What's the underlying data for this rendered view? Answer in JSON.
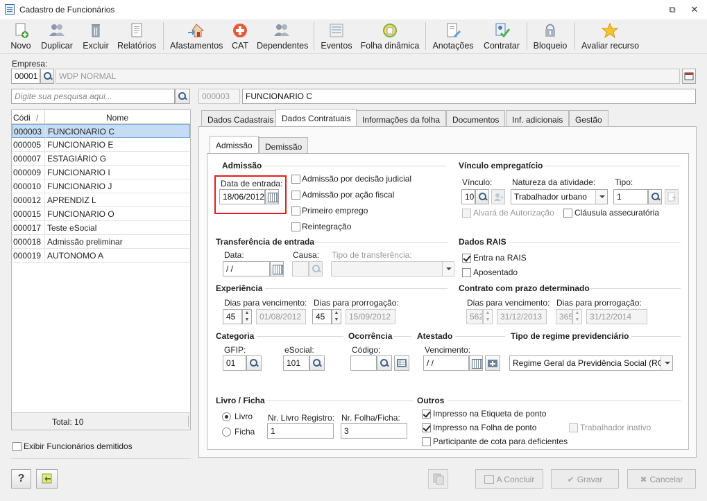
{
  "window": {
    "title": "Cadastro de Funcionários"
  },
  "toolbar": [
    {
      "label": "Novo",
      "icon": "new-doc-icon"
    },
    {
      "label": "Duplicar",
      "icon": "users-icon"
    },
    {
      "label": "Excluir",
      "icon": "trash-icon"
    },
    {
      "label": "Relatórios",
      "icon": "report-icon"
    },
    {
      "label": "Afastamentos",
      "icon": "house-arrow-icon"
    },
    {
      "label": "CAT",
      "icon": "medical-cross-icon"
    },
    {
      "label": "Dependentes",
      "icon": "users-icon"
    },
    {
      "label": "Eventos",
      "icon": "list-icon"
    },
    {
      "label": "Folha dinâmica",
      "icon": "refresh-sheet-icon"
    },
    {
      "label": "Anotações",
      "icon": "note-pen-icon"
    },
    {
      "label": "Contratar",
      "icon": "contract-check-icon"
    },
    {
      "label": "Bloqueio",
      "icon": "lock-icon"
    },
    {
      "label": "Avaliar recurso",
      "icon": "star-icon"
    }
  ],
  "empresa": {
    "label": "Empresa:",
    "code": "00001",
    "name": "WDP NORMAL"
  },
  "search": {
    "placeholder": "Digite sua pesquisa aqui...",
    "selected_code": "000003",
    "selected_name": "FUNCIONARIO C"
  },
  "list": {
    "col_code": "Códi",
    "sort_mark": "/",
    "col_name": "Nome",
    "rows": [
      {
        "code": "000003",
        "name": "FUNCIONARIO C"
      },
      {
        "code": "000005",
        "name": "FUNCIONARIO E"
      },
      {
        "code": "000007",
        "name": "ESTAGIÁRIO G"
      },
      {
        "code": "000009",
        "name": "FUNCIONARIO I"
      },
      {
        "code": "000010",
        "name": "FUNCIONARIO J"
      },
      {
        "code": "000012",
        "name": "APRENDIZ L"
      },
      {
        "code": "000015",
        "name": "FUNCIONARIO O"
      },
      {
        "code": "000017",
        "name": "Teste eSocial"
      },
      {
        "code": "000018",
        "name": "Admissão preliminar"
      },
      {
        "code": "000019",
        "name": "AUTONOMO A"
      }
    ],
    "total": "Total: 10",
    "show_dismissed": "Exibir Funcionários demitidos"
  },
  "tabs": [
    "Dados Cadastrais",
    "Dados Contratuais",
    "Informações da folha",
    "Documentos",
    "Inf. adicionais",
    "Gestão"
  ],
  "subtabs": [
    "Admissão",
    "Demissão"
  ],
  "admissao": {
    "title": "Admissão",
    "date_label": "Data de entrada:",
    "date_value": "18/06/2012",
    "options": [
      "Admissão por decisão judicial",
      "Admissão por ação fiscal",
      "Primeiro emprego",
      "Reintegração"
    ]
  },
  "vinculo": {
    "title": "Vínculo empregatício",
    "vinculo_label": "Vínculo:",
    "vinculo_value": "10",
    "natureza_label": "Natureza da atividade:",
    "natureza_value": "Trabalhador urbano",
    "tipo_label": "Tipo:",
    "tipo_value": "1",
    "alvara": "Alvará de Autorização",
    "clausula": "Cláusula assecuratória"
  },
  "transferencia": {
    "title": "Transferência de entrada",
    "data_label": "Data:",
    "data_value": " / /",
    "causa_label": "Causa:",
    "tipo_label": "Tipo de transferência:"
  },
  "rais": {
    "title": "Dados RAIS",
    "entra": "Entra na RAIS",
    "aposentado": "Aposentado"
  },
  "experiencia": {
    "title": "Experiência",
    "venc_label": "Dias para vencimento:",
    "venc_days": "45",
    "venc_date": "01/08/2012",
    "prorr_label": "Dias para prorrogação:",
    "prorr_days": "45",
    "prorr_date": "15/09/2012"
  },
  "prazo": {
    "title": "Contrato com prazo determinado",
    "venc_label": "Dias para vencimento:",
    "venc_days": "562",
    "venc_date": "31/12/2013",
    "prorr_label": "Dias para prorrogação:",
    "prorr_days": "365",
    "prorr_date": "31/12/2014"
  },
  "categoria": {
    "title": "Categoria",
    "gfip_label": "GFIP:",
    "gfip_value": "01",
    "esocial_label": "eSocial:",
    "esocial_value": "101"
  },
  "ocorrencia": {
    "title": "Ocorrência",
    "codigo_label": "Código:"
  },
  "atestado": {
    "title": "Atestado",
    "venc_label": "Vencimento:",
    "venc_value": " / /"
  },
  "regime": {
    "title": "Tipo de regime previdenciário",
    "value": "Regime Geral da Previdência Social (RGP"
  },
  "livro": {
    "title": "Livro / Ficha",
    "opt_livro": "Livro",
    "opt_ficha": "Ficha",
    "nr_livro_label": "Nr. Livro Registro:",
    "nr_livro_value": "1",
    "nr_folha_label": "Nr. Folha/Ficha:",
    "nr_folha_value": "3"
  },
  "outros": {
    "title": "Outros",
    "etiqueta": "Impresso na Etiqueta de ponto",
    "folha": "Impresso na Folha de ponto",
    "inativo": "Trabalhador inativo",
    "cota": "Participante de cota para deficientes"
  },
  "buttons": {
    "concluir": "A Concluir",
    "gravar": "Gravar",
    "cancelar": "Cancelar",
    "help": "?"
  }
}
